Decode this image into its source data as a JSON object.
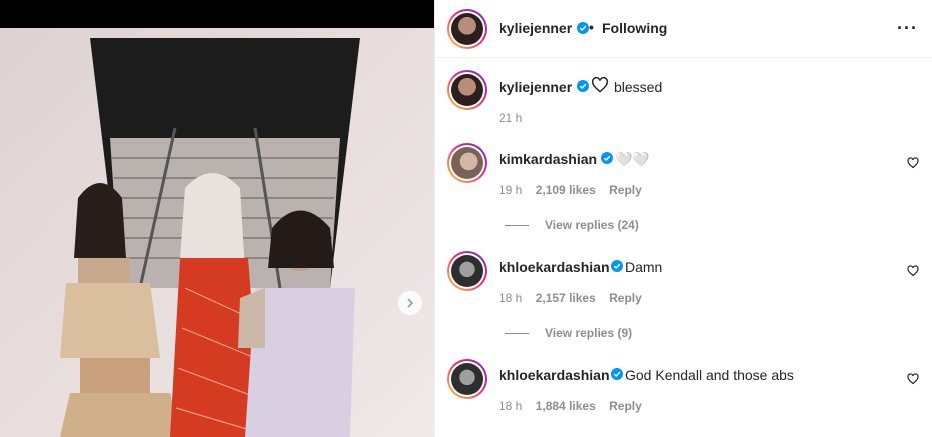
{
  "post": {
    "author": "kyliejenner",
    "follow_status": "Following",
    "caption": "blessed",
    "caption_time": "21 h"
  },
  "comments": [
    {
      "user": "kimkardashian",
      "text": "🤍🤍",
      "time": "19 h",
      "likes": "2,109 likes",
      "reply": "Reply",
      "view_replies": "View replies (24)"
    },
    {
      "user": "khloekardashian",
      "text": "Damn",
      "time": "18 h",
      "likes": "2,157 likes",
      "reply": "Reply",
      "view_replies": "View replies (9)"
    },
    {
      "user": "khloekardashian",
      "text": "God Kendall and those abs",
      "time": "18 h",
      "likes": "1,884 likes",
      "reply": "Reply",
      "view_replies": ""
    }
  ],
  "icons": {
    "verified": "verified-badge-icon",
    "more": "more-options-icon",
    "heart": "heart-icon",
    "next": "chevron-right-icon"
  },
  "colors": {
    "verified": "#0095f6",
    "muted": "#8e8e8e",
    "text": "#262626"
  }
}
